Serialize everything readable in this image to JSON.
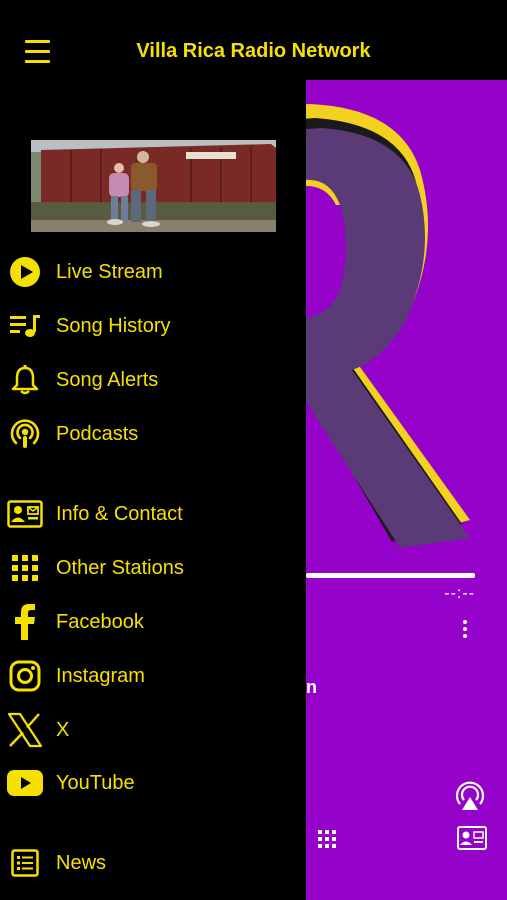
{
  "app": {
    "title": "Villa Rica Radio Network"
  },
  "player": {
    "time": "--:--",
    "station_fragment": "n"
  },
  "menu": {
    "items": [
      {
        "label": "Live Stream",
        "icon": "play-circle-icon"
      },
      {
        "label": "Song History",
        "icon": "playlist-icon"
      },
      {
        "label": "Song Alerts",
        "icon": "bell-icon"
      },
      {
        "label": "Podcasts",
        "icon": "podcast-icon"
      },
      {
        "label": "Info & Contact",
        "icon": "contact-card-icon"
      },
      {
        "label": "Other Stations",
        "icon": "grid-icon"
      },
      {
        "label": "Facebook",
        "icon": "facebook-icon"
      },
      {
        "label": "Instagram",
        "icon": "instagram-icon"
      },
      {
        "label": "X",
        "icon": "x-icon"
      },
      {
        "label": "YouTube",
        "icon": "youtube-icon"
      },
      {
        "label": "News",
        "icon": "news-icon"
      }
    ]
  },
  "colors": {
    "accent": "#F5E000",
    "background": "#000000",
    "brand_purple": "#9502C9",
    "logo_purple": "#5B3A78"
  }
}
